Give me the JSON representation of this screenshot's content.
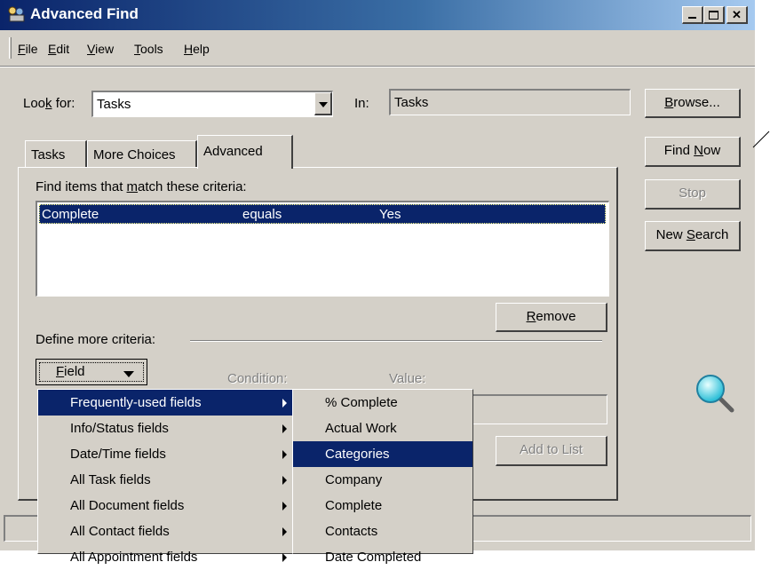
{
  "window": {
    "title": "Advanced Find"
  },
  "menu": [
    "File",
    "Edit",
    "View",
    "Tools",
    "Help"
  ],
  "lookfor": {
    "label": "Look for:",
    "value": "Tasks"
  },
  "in": {
    "label": "In:",
    "value": "Tasks"
  },
  "buttons": {
    "browse": "Browse...",
    "find_now": "Find Now",
    "stop": "Stop",
    "new_search": "New Search",
    "remove": "Remove",
    "add_to_list": "Add to List",
    "field": "Field"
  },
  "tabs": [
    "Tasks",
    "More Choices",
    "Advanced"
  ],
  "criteria": {
    "label": "Find items that match these criteria:",
    "rows": [
      {
        "field": "Complete",
        "condition": "equals",
        "value": "Yes"
      }
    ]
  },
  "define_label": "Define more criteria:",
  "condition_label": "Condition:",
  "value_label": "Value:",
  "field_menu": {
    "items": [
      "Frequently-used fields",
      "Info/Status fields",
      "Date/Time fields",
      "All Task fields",
      "All Document fields",
      "All Contact fields",
      "All Appointment fields"
    ],
    "highlighted": "Frequently-used fields"
  },
  "submenu": {
    "items": [
      "% Complete",
      "Actual Work",
      "Categories",
      "Company",
      "Complete",
      "Contacts",
      "Date Completed"
    ],
    "highlighted": "Categories"
  },
  "colors": {
    "titlebar": "#0a246a",
    "highlight": "#0a246a",
    "face": "#d4d0c8"
  }
}
